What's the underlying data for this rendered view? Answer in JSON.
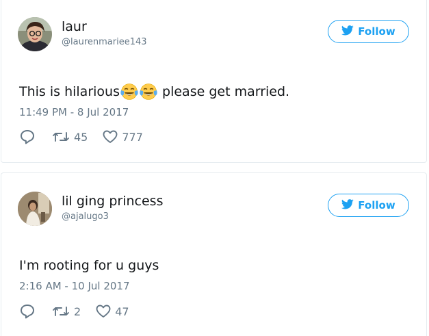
{
  "tweets": [
    {
      "author": {
        "name": "laur",
        "handle": "@laurenmariee143"
      },
      "follow_label": "Follow",
      "text_before": "This is hilarious",
      "emojis": [
        "tears-of-joy",
        "tears-of-joy"
      ],
      "text_after": " please get married.",
      "timestamp": "11:49 PM - 8 Jul 2017",
      "retweets": "45",
      "likes": "777"
    },
    {
      "author": {
        "name": "lil ging princess",
        "handle": "@ajalugo3"
      },
      "follow_label": "Follow",
      "text_before": "I'm rooting for u guys",
      "emojis": [],
      "text_after": "",
      "timestamp": "2:16 AM - 10 Jul 2017",
      "retweets": "2",
      "likes": "47"
    }
  ],
  "icons": {
    "bird": "twitter-bird-icon",
    "reply": "reply-icon",
    "retweet": "retweet-icon",
    "like": "heart-icon"
  },
  "colors": {
    "accent": "#1da1f2",
    "muted": "#657786",
    "text": "#14171a",
    "border": "#e6ecf0"
  }
}
